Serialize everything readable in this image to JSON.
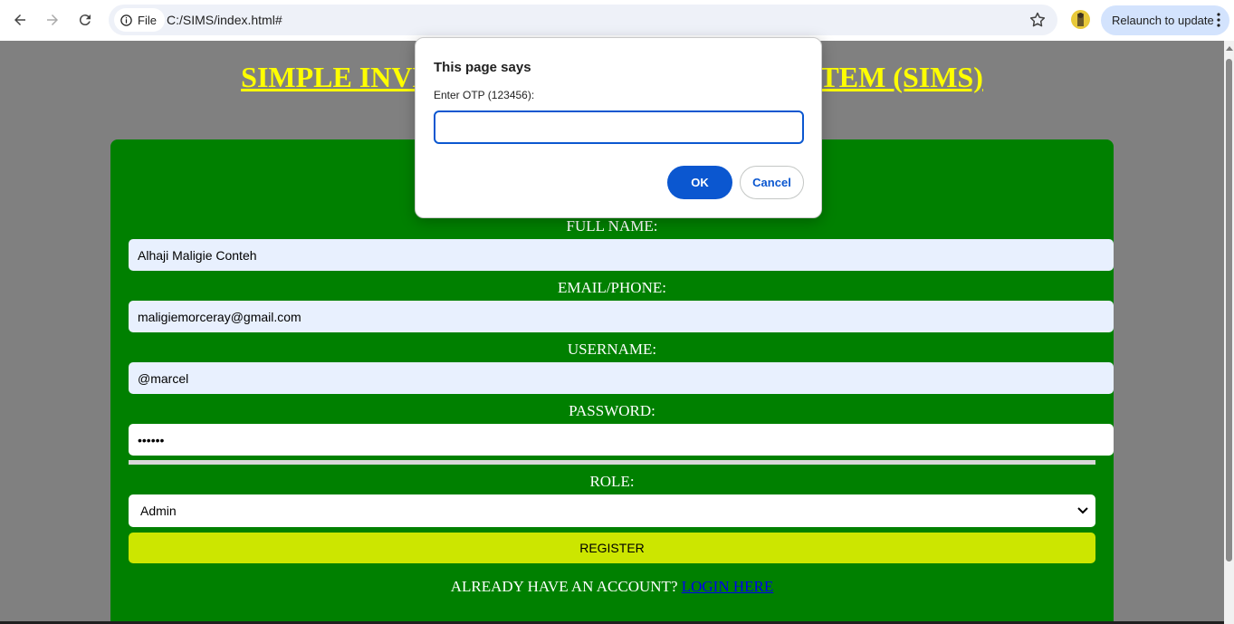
{
  "browser": {
    "site_info_label": "File",
    "url": "C:/SIMS/index.html#",
    "relaunch_label": "Relaunch to update"
  },
  "page": {
    "title": "SIMPLE INVENTORY MANAGEMENT SYSTEM (SIMS)",
    "fields": {
      "full_name_label": "FULL NAME:",
      "full_name_value": "Alhaji Maligie Conteh",
      "email_label": "EMAIL/PHONE:",
      "email_value": "maligiemorceray@gmail.com",
      "username_label": "USERNAME:",
      "username_value": "@marcel",
      "password_label": "PASSWORD:",
      "password_value": "••••••",
      "role_label": "ROLE:",
      "role_value": "Admin"
    },
    "register_label": "REGISTER",
    "login_prompt": "ALREADY HAVE AN ACCOUNT?",
    "login_link": "LOGIN HERE"
  },
  "dialog": {
    "title": "This page says",
    "message": "Enter OTP (123456):",
    "input_value": "",
    "ok_label": "OK",
    "cancel_label": "Cancel"
  },
  "colors": {
    "title_yellow": "#ffff00",
    "form_green": "#008000",
    "register_lime": "#cce600",
    "overlay_gray": "#808080",
    "dialog_accent": "#0b57d0"
  }
}
